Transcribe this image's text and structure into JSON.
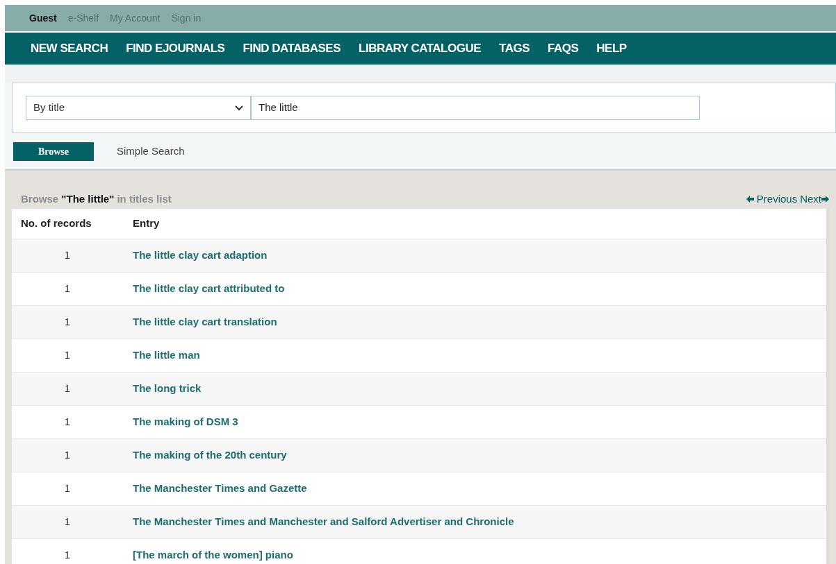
{
  "user_bar": [
    {
      "label": "Guest",
      "kind": "user"
    },
    {
      "label": "e-Shelf",
      "kind": "link"
    },
    {
      "label": "My Account",
      "kind": "link"
    },
    {
      "label": "Sign in",
      "kind": "link"
    }
  ],
  "nav": [
    "NEW SEARCH",
    "FIND EJOURNALS",
    "FIND DATABASES",
    "LIBRARY CATALOGUE",
    "TAGS",
    "FAQS",
    "HELP"
  ],
  "search": {
    "scope": "By title",
    "query": "The little"
  },
  "actions": {
    "browse": "Browse",
    "simple_search": "Simple Search"
  },
  "results": {
    "heading": "Browse **\"The little\"** in titles list",
    "previous": "Previous",
    "next": "Next",
    "columns": [
      "No. of records",
      "Entry"
    ],
    "rows": [
      {
        "count": "1",
        "entry": "The little clay cart adaption"
      },
      {
        "count": "1",
        "entry": "The little clay cart attributed to"
      },
      {
        "count": "1",
        "entry": "The little clay cart translation"
      },
      {
        "count": "1",
        "entry": "The little man"
      },
      {
        "count": "1",
        "entry": "The long trick"
      },
      {
        "count": "1",
        "entry": "The making of DSM 3"
      },
      {
        "count": "1",
        "entry": "The making of the 20th century"
      },
      {
        "count": "1",
        "entry": "The Manchester Times and Gazette"
      },
      {
        "count": "1",
        "entry": "The Manchester Times and Manchester and Salford Advertiser and Chronicle"
      },
      {
        "count": "1",
        "entry": "[The march of the women] piano"
      }
    ]
  }
}
